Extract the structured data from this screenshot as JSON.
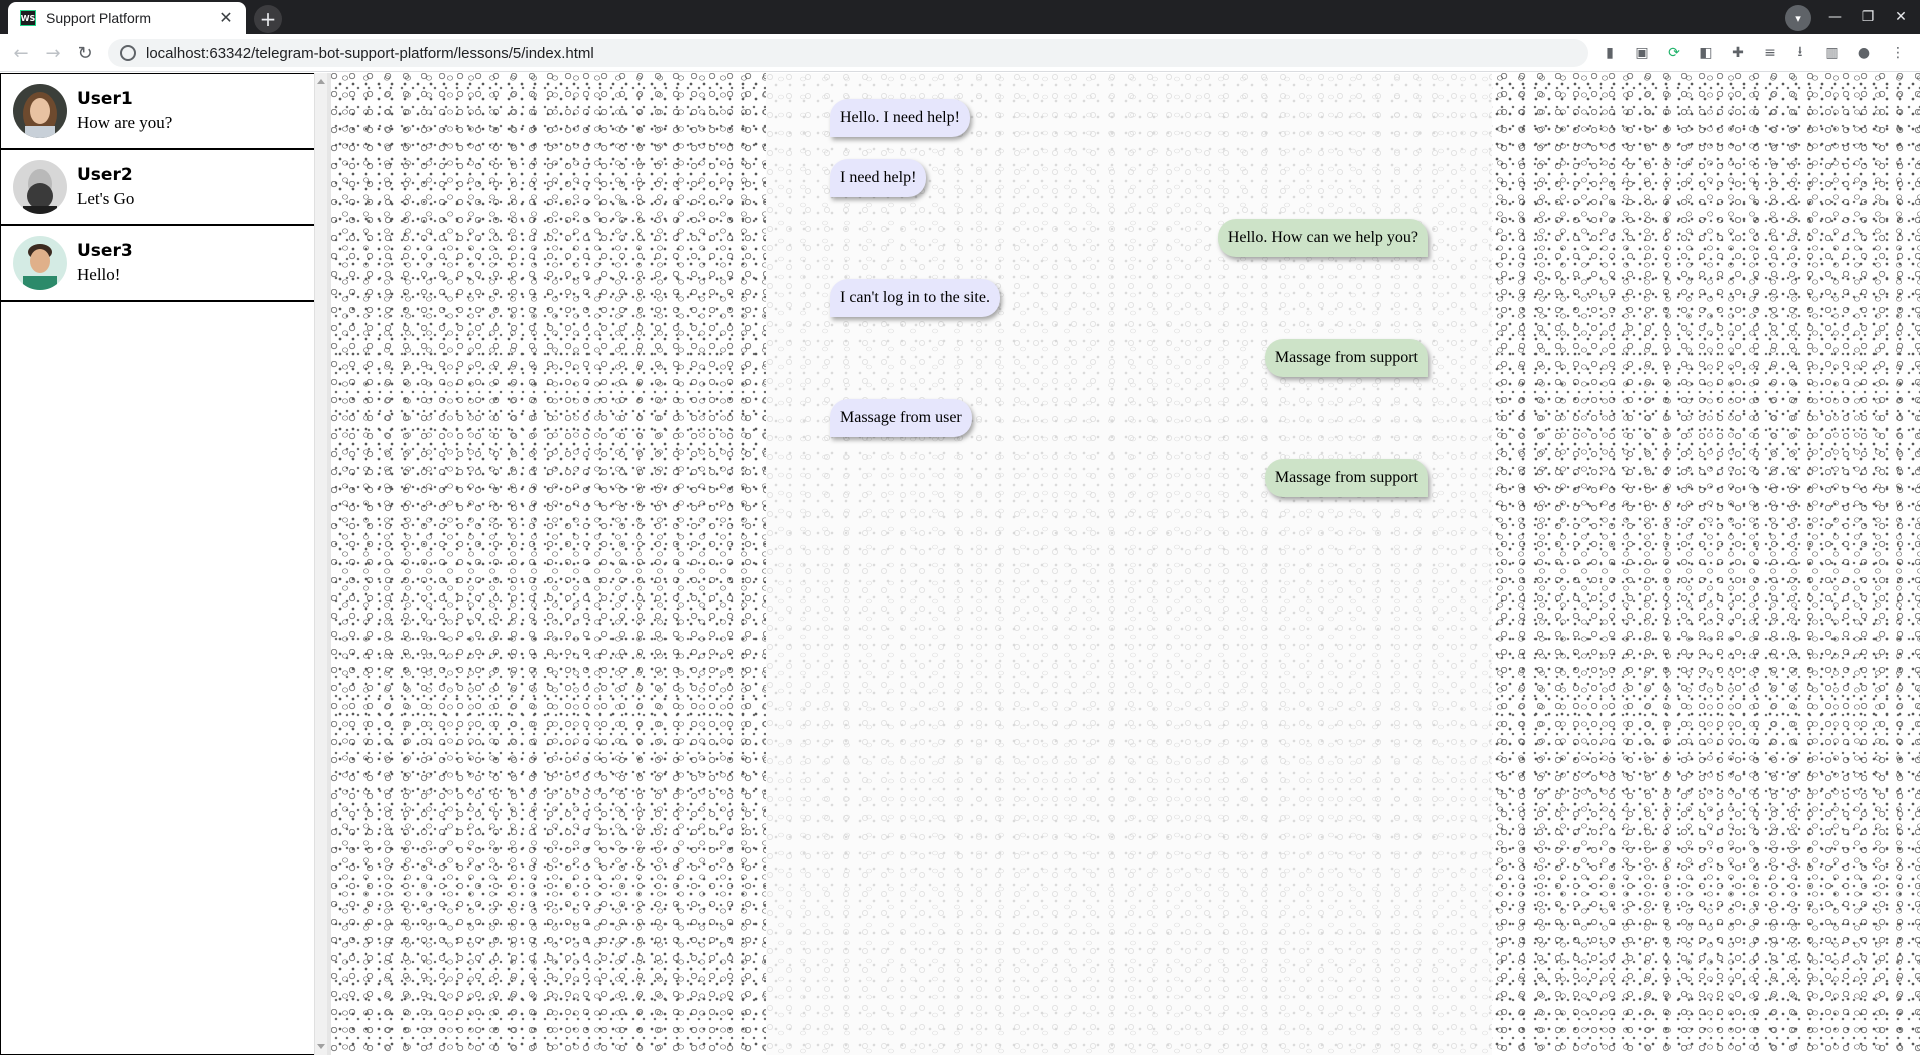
{
  "browser": {
    "tab_title": "Support Platform",
    "tab_favicon": "WS",
    "url": "localhost:63342/telegram-bot-support-platform/lessons/5/index.html"
  },
  "icons": {
    "new_tab": "plus-icon",
    "back": "arrow-left-icon",
    "forward": "arrow-right-icon",
    "reload": "reload-icon"
  },
  "users": [
    {
      "name": "User1",
      "last_message": "How are you?"
    },
    {
      "name": "User2",
      "last_message": "Let's Go"
    },
    {
      "name": "User3",
      "last_message": "Hello!"
    }
  ],
  "messages": [
    {
      "from": "user",
      "text": "Hello. I need help!"
    },
    {
      "from": "user",
      "text": "I need help!"
    },
    {
      "from": "support",
      "text": "Hello. How can we help you?"
    },
    {
      "from": "user",
      "text": "I can't log in to the site."
    },
    {
      "from": "support",
      "text": "Massage from support"
    },
    {
      "from": "user",
      "text": "Massage from user"
    },
    {
      "from": "support",
      "text": "Massage from support"
    }
  ],
  "colors": {
    "user_bubble": "#e6e6fc",
    "support_bubble": "#cde3c8",
    "titlebar": "#202124"
  }
}
